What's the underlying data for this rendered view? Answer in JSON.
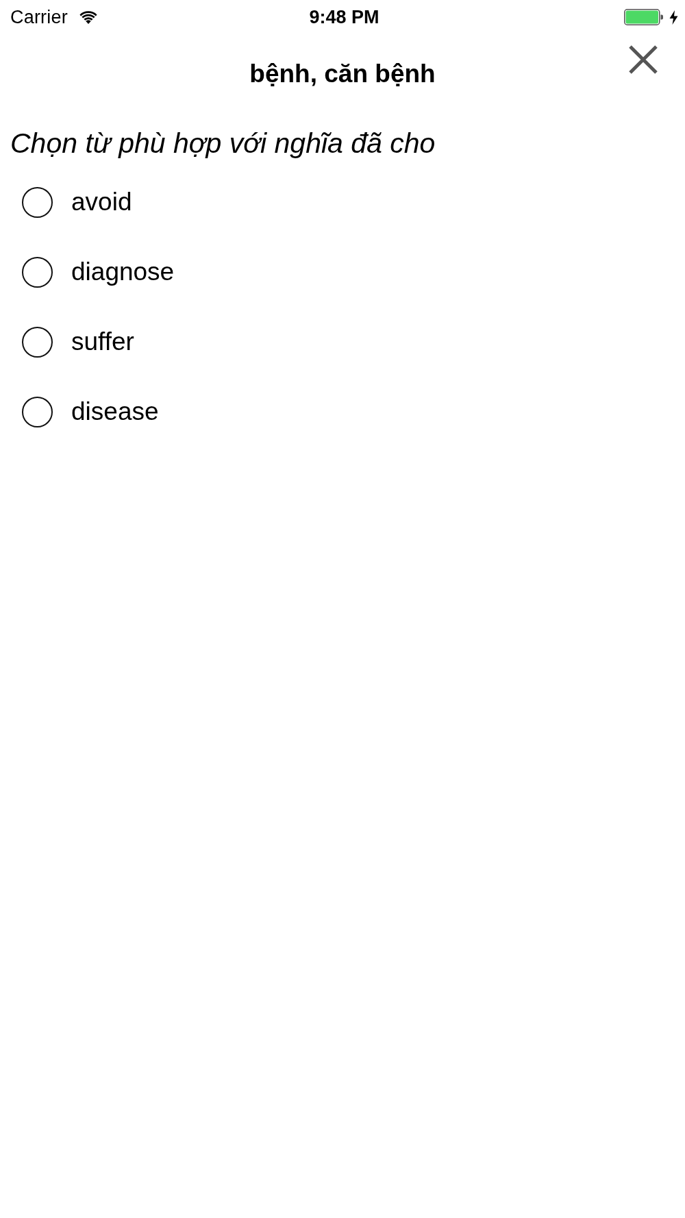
{
  "status_bar": {
    "carrier": "Carrier",
    "time": "9:48 PM",
    "charging": true
  },
  "header": {
    "title": "bệnh, căn bệnh"
  },
  "question": {
    "instruction": "Chọn từ phù hợp với nghĩa đã cho",
    "options": [
      {
        "label": "avoid",
        "selected": false
      },
      {
        "label": "diagnose",
        "selected": false
      },
      {
        "label": "suffer",
        "selected": false
      },
      {
        "label": "disease",
        "selected": false
      }
    ]
  }
}
